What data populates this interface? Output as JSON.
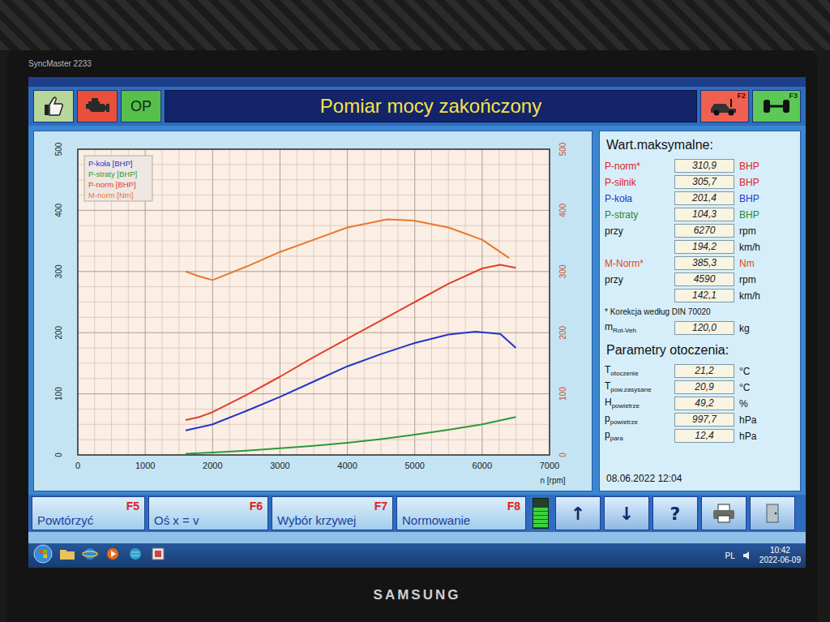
{
  "monitor": {
    "model": "SyncMaster 2233",
    "brand": "SAMSUNG"
  },
  "toolbar": {
    "op_label": "OP",
    "title": "Pomiar mocy zakończony",
    "right_buttons": [
      {
        "key": "F2",
        "color": "#f06050"
      },
      {
        "key": "F3",
        "color": "#5cc856"
      }
    ]
  },
  "chart": {
    "series": [
      {
        "legend": "P-koła [BHP]",
        "axis": "left",
        "color": "#2234c8",
        "rpm": [
          1600,
          2000,
          2500,
          3000,
          3500,
          4000,
          4500,
          5000,
          5500,
          5900,
          6270,
          6500
        ],
        "values": [
          40,
          50,
          72,
          95,
          120,
          145,
          165,
          183,
          197,
          201.4,
          198,
          175
        ]
      },
      {
        "legend": "P-straty [BHP]",
        "axis": "left",
        "color": "#2c9a3a",
        "rpm": [
          1600,
          2000,
          2500,
          3000,
          3500,
          4000,
          4500,
          5000,
          5500,
          6000,
          6500
        ],
        "values": [
          2,
          4,
          7,
          11,
          15,
          20,
          26,
          33,
          41,
          50,
          62
        ]
      },
      {
        "legend": "P-norm [BHP]",
        "axis": "left",
        "color": "#e0402a",
        "rpm": [
          1600,
          1800,
          2000,
          2500,
          3000,
          3500,
          4000,
          4500,
          5000,
          5500,
          6000,
          6270,
          6500
        ],
        "values": [
          57,
          62,
          70,
          98,
          128,
          160,
          190,
          220,
          250,
          280,
          305,
          310.9,
          306
        ]
      },
      {
        "legend": "M-norm [Nm]",
        "axis": "right",
        "color": "#e8782e",
        "rpm": [
          1600,
          1800,
          2000,
          2500,
          3000,
          3500,
          4000,
          4590,
          5000,
          5500,
          6000,
          6400
        ],
        "values": [
          300,
          292,
          286,
          308,
          332,
          352,
          372,
          385.3,
          383,
          372,
          352,
          322
        ]
      }
    ],
    "x_ticks": [
      "0",
      "1000",
      "2000",
      "3000",
      "4000",
      "5000",
      "6000",
      "7000"
    ],
    "x_label": "n [rpm]",
    "y_left_ticks": [
      "0",
      "100",
      "200",
      "300",
      "400",
      "500"
    ],
    "y_right_ticks": [
      "0",
      "100",
      "200",
      "300",
      "400",
      "500"
    ]
  },
  "max_values": {
    "title": "Wart.maksymalne:",
    "rows": [
      {
        "label": "P-norm*",
        "value": "310,9",
        "unit": "BHP",
        "color": "#e02020"
      },
      {
        "label": "P-silnik",
        "value": "305,7",
        "unit": "BHP",
        "color": "#e02020"
      },
      {
        "label": "P-koła",
        "value": "201,4",
        "unit": "BHP",
        "color": "#1f36c8"
      },
      {
        "label": "P-straty",
        "value": "104,3",
        "unit": "BHP",
        "color": "#1f8a30"
      },
      {
        "label": "przy",
        "value": "6270",
        "unit": "rpm",
        "color": "#111111"
      },
      {
        "value": "194,2",
        "unit": "km/h",
        "color": "#111111"
      },
      {
        "label": "M-Norm*",
        "value": "385,3",
        "unit": "Nm",
        "color": "#e04a20"
      },
      {
        "label": "przy",
        "value": "4590",
        "unit": "rpm",
        "color": "#111111"
      },
      {
        "value": "142,1",
        "unit": "km/h",
        "color": "#111111"
      }
    ],
    "note": "* Korekcja według DIN 70020",
    "mass": {
      "label": "m",
      "sub": "Rot-Veh",
      "value": "120,0",
      "unit": "kg"
    }
  },
  "ambient": {
    "title": "Parametry otoczenia:",
    "rows": [
      {
        "label": "T",
        "sub": "otoczenie",
        "value": "21,2",
        "unit": "°C"
      },
      {
        "label": "T",
        "sub": "pow.zasysane",
        "value": "20,9",
        "unit": "°C"
      },
      {
        "label": "H",
        "sub": "powietrze",
        "value": "49,2",
        "unit": "%"
      },
      {
        "label": "p",
        "sub": "powietrze",
        "value": "997,7",
        "unit": "hPa"
      },
      {
        "label": "p",
        "sub": "para",
        "value": "12,4",
        "unit": "hPa"
      }
    ]
  },
  "datetime": "08.06.2022 12:04",
  "bottom_bar": {
    "buttons": [
      {
        "label": "Powtórzyć",
        "key": "F5"
      },
      {
        "label": "Oś x = v",
        "key": "F6"
      },
      {
        "label": "Wybór krzywej",
        "key": "F7"
      },
      {
        "label": "Normowanie",
        "key": "F8"
      }
    ],
    "meter": {
      "level": 0.7
    },
    "nav": [
      "↑",
      "↓",
      "?"
    ]
  },
  "taskbar": {
    "lang": "PL",
    "time": "10:42",
    "date": "2022-06-09"
  }
}
